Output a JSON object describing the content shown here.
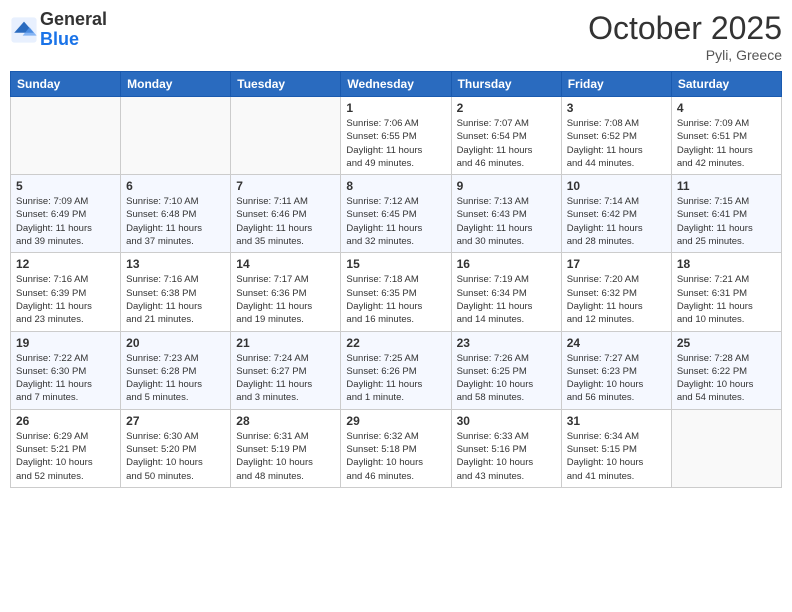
{
  "header": {
    "logo_general": "General",
    "logo_blue": "Blue",
    "month": "October 2025",
    "location": "Pyli, Greece"
  },
  "days_of_week": [
    "Sunday",
    "Monday",
    "Tuesday",
    "Wednesday",
    "Thursday",
    "Friday",
    "Saturday"
  ],
  "weeks": [
    [
      {
        "day": "",
        "info": ""
      },
      {
        "day": "",
        "info": ""
      },
      {
        "day": "",
        "info": ""
      },
      {
        "day": "1",
        "info": "Sunrise: 7:06 AM\nSunset: 6:55 PM\nDaylight: 11 hours\nand 49 minutes."
      },
      {
        "day": "2",
        "info": "Sunrise: 7:07 AM\nSunset: 6:54 PM\nDaylight: 11 hours\nand 46 minutes."
      },
      {
        "day": "3",
        "info": "Sunrise: 7:08 AM\nSunset: 6:52 PM\nDaylight: 11 hours\nand 44 minutes."
      },
      {
        "day": "4",
        "info": "Sunrise: 7:09 AM\nSunset: 6:51 PM\nDaylight: 11 hours\nand 42 minutes."
      }
    ],
    [
      {
        "day": "5",
        "info": "Sunrise: 7:09 AM\nSunset: 6:49 PM\nDaylight: 11 hours\nand 39 minutes."
      },
      {
        "day": "6",
        "info": "Sunrise: 7:10 AM\nSunset: 6:48 PM\nDaylight: 11 hours\nand 37 minutes."
      },
      {
        "day": "7",
        "info": "Sunrise: 7:11 AM\nSunset: 6:46 PM\nDaylight: 11 hours\nand 35 minutes."
      },
      {
        "day": "8",
        "info": "Sunrise: 7:12 AM\nSunset: 6:45 PM\nDaylight: 11 hours\nand 32 minutes."
      },
      {
        "day": "9",
        "info": "Sunrise: 7:13 AM\nSunset: 6:43 PM\nDaylight: 11 hours\nand 30 minutes."
      },
      {
        "day": "10",
        "info": "Sunrise: 7:14 AM\nSunset: 6:42 PM\nDaylight: 11 hours\nand 28 minutes."
      },
      {
        "day": "11",
        "info": "Sunrise: 7:15 AM\nSunset: 6:41 PM\nDaylight: 11 hours\nand 25 minutes."
      }
    ],
    [
      {
        "day": "12",
        "info": "Sunrise: 7:16 AM\nSunset: 6:39 PM\nDaylight: 11 hours\nand 23 minutes."
      },
      {
        "day": "13",
        "info": "Sunrise: 7:16 AM\nSunset: 6:38 PM\nDaylight: 11 hours\nand 21 minutes."
      },
      {
        "day": "14",
        "info": "Sunrise: 7:17 AM\nSunset: 6:36 PM\nDaylight: 11 hours\nand 19 minutes."
      },
      {
        "day": "15",
        "info": "Sunrise: 7:18 AM\nSunset: 6:35 PM\nDaylight: 11 hours\nand 16 minutes."
      },
      {
        "day": "16",
        "info": "Sunrise: 7:19 AM\nSunset: 6:34 PM\nDaylight: 11 hours\nand 14 minutes."
      },
      {
        "day": "17",
        "info": "Sunrise: 7:20 AM\nSunset: 6:32 PM\nDaylight: 11 hours\nand 12 minutes."
      },
      {
        "day": "18",
        "info": "Sunrise: 7:21 AM\nSunset: 6:31 PM\nDaylight: 11 hours\nand 10 minutes."
      }
    ],
    [
      {
        "day": "19",
        "info": "Sunrise: 7:22 AM\nSunset: 6:30 PM\nDaylight: 11 hours\nand 7 minutes."
      },
      {
        "day": "20",
        "info": "Sunrise: 7:23 AM\nSunset: 6:28 PM\nDaylight: 11 hours\nand 5 minutes."
      },
      {
        "day": "21",
        "info": "Sunrise: 7:24 AM\nSunset: 6:27 PM\nDaylight: 11 hours\nand 3 minutes."
      },
      {
        "day": "22",
        "info": "Sunrise: 7:25 AM\nSunset: 6:26 PM\nDaylight: 11 hours\nand 1 minute."
      },
      {
        "day": "23",
        "info": "Sunrise: 7:26 AM\nSunset: 6:25 PM\nDaylight: 10 hours\nand 58 minutes."
      },
      {
        "day": "24",
        "info": "Sunrise: 7:27 AM\nSunset: 6:23 PM\nDaylight: 10 hours\nand 56 minutes."
      },
      {
        "day": "25",
        "info": "Sunrise: 7:28 AM\nSunset: 6:22 PM\nDaylight: 10 hours\nand 54 minutes."
      }
    ],
    [
      {
        "day": "26",
        "info": "Sunrise: 6:29 AM\nSunset: 5:21 PM\nDaylight: 10 hours\nand 52 minutes."
      },
      {
        "day": "27",
        "info": "Sunrise: 6:30 AM\nSunset: 5:20 PM\nDaylight: 10 hours\nand 50 minutes."
      },
      {
        "day": "28",
        "info": "Sunrise: 6:31 AM\nSunset: 5:19 PM\nDaylight: 10 hours\nand 48 minutes."
      },
      {
        "day": "29",
        "info": "Sunrise: 6:32 AM\nSunset: 5:18 PM\nDaylight: 10 hours\nand 46 minutes."
      },
      {
        "day": "30",
        "info": "Sunrise: 6:33 AM\nSunset: 5:16 PM\nDaylight: 10 hours\nand 43 minutes."
      },
      {
        "day": "31",
        "info": "Sunrise: 6:34 AM\nSunset: 5:15 PM\nDaylight: 10 hours\nand 41 minutes."
      },
      {
        "day": "",
        "info": ""
      }
    ]
  ]
}
